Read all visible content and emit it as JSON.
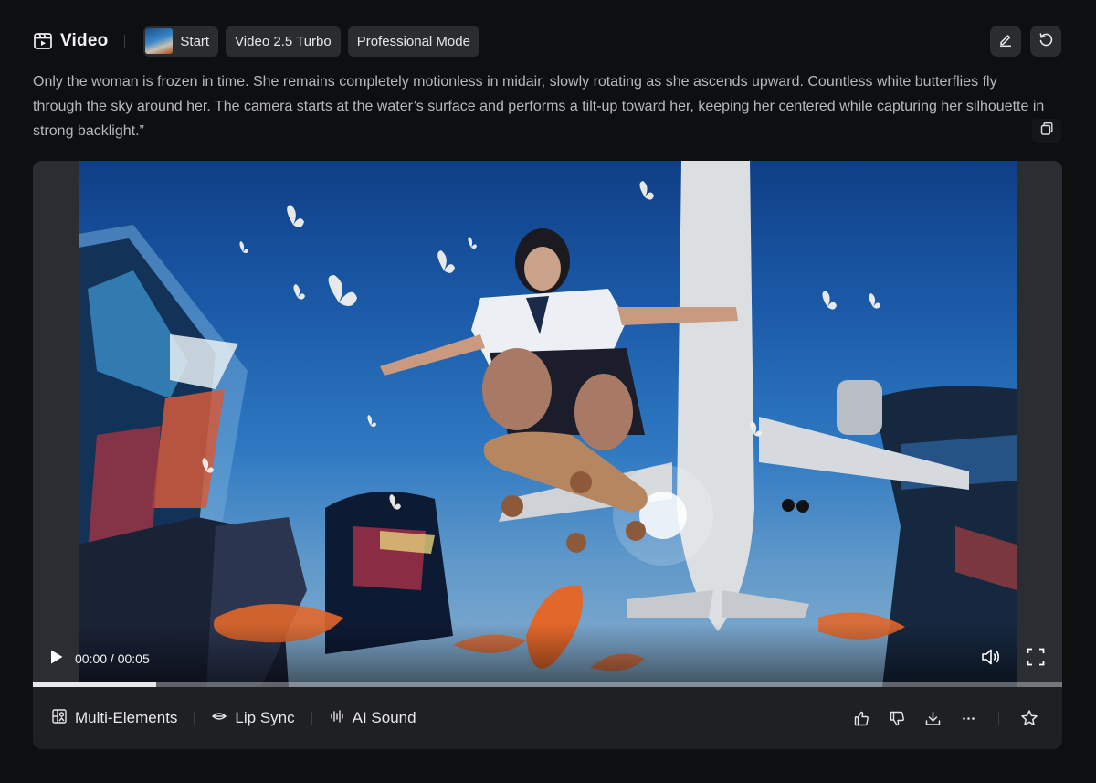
{
  "header": {
    "title": "Video",
    "title_icon": "video-icon",
    "chips": [
      {
        "label": "Start",
        "has_thumbnail": true
      },
      {
        "label": "Video 2.5 Turbo"
      },
      {
        "label": "Professional Mode"
      }
    ],
    "actions": [
      "edit-icon",
      "undo-icon"
    ]
  },
  "prompt": {
    "text": "Only the woman is frozen in time. She remains completely motionless in midair, slowly rotating as she ascends upward. Countless white butterflies fly through the sky around her. The camera starts at the water’s surface and performs a tilt-up toward her, keeping her centered while capturing her silhouette in strong backlight.”",
    "copy_icon": "copy-icon"
  },
  "player": {
    "time": "00:00 / 00:05",
    "progress": 0.12,
    "controls": [
      "play-icon",
      "volume-icon",
      "fullscreen-icon"
    ]
  },
  "toolbar": {
    "tools": [
      {
        "label": "Multi-Elements",
        "icon": "multi-elements-icon"
      },
      {
        "label": "Lip Sync",
        "icon": "lip-sync-icon"
      },
      {
        "label": "AI Sound",
        "icon": "ai-sound-icon"
      }
    ],
    "actions": [
      "thumbs-up-icon",
      "thumbs-down-icon",
      "download-icon",
      "more-icon",
      "star-icon"
    ]
  },
  "colors": {
    "background": "#0e0f11",
    "chip": "#2a2c30",
    "panel": "#1e2023",
    "sky": "#1b5aa8"
  }
}
